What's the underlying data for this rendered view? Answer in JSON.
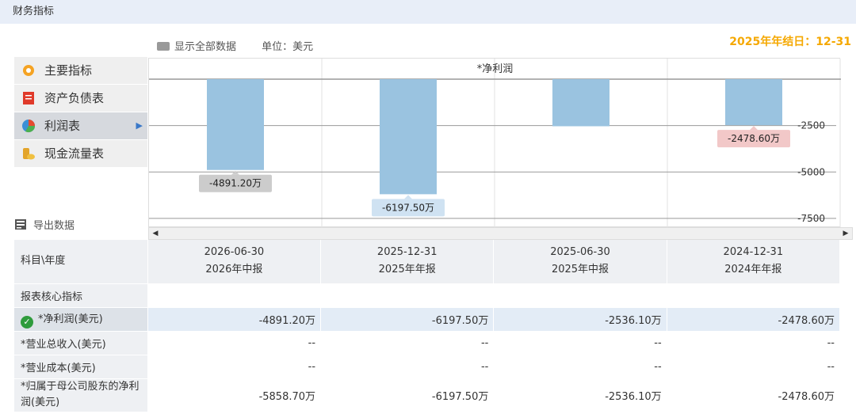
{
  "topbar": {
    "title": "财务指标"
  },
  "toolbar": {
    "show_all": "显示全部数据",
    "unit": "单位：美元"
  },
  "year_end": "2025年年结日：12-31",
  "nav": {
    "items": [
      {
        "label": "主要指标",
        "icon": "gear-icon"
      },
      {
        "label": "资产负债表",
        "icon": "document-icon"
      },
      {
        "label": "利润表",
        "icon": "pie-chart-icon"
      },
      {
        "label": "现金流量表",
        "icon": "coins-icon"
      }
    ],
    "active_index": 2,
    "export_label": "导出数据"
  },
  "chart_data": {
    "type": "bar",
    "title": "*净利润",
    "categories": [
      "2026-06-30",
      "2025-12-31",
      "2025-06-30",
      "2024-12-31"
    ],
    "values": [
      -4891.2,
      -6197.5,
      -2536.1,
      -2478.6
    ],
    "value_labels": [
      "-4891.20万",
      "-6197.50万",
      "",
      "-2478.60万"
    ],
    "y_ticks": [
      "-2500",
      "-5000",
      "-7500"
    ],
    "ylim": [
      -8100,
      0
    ],
    "bar_color": "#9ac3e0",
    "label_colors": [
      "#cccccc",
      "#cfe2f2",
      "",
      "#f2c8c8"
    ]
  },
  "table": {
    "header_label": "科目\\年度",
    "columns": [
      {
        "date": "2026-06-30",
        "report": "2026年中报"
      },
      {
        "date": "2025-12-31",
        "report": "2025年年报"
      },
      {
        "date": "2025-06-30",
        "report": "2025年中报"
      },
      {
        "date": "2024-12-31",
        "report": "2024年年报"
      }
    ],
    "core_label": "报表核心指标",
    "rows": [
      {
        "label": "*净利润(美元)",
        "values": [
          "-4891.20",
          "-6197.50",
          "-2536.10",
          "-2478.60"
        ],
        "unit": "万"
      },
      {
        "label": "*营业总收入(美元)",
        "values": [
          "--",
          "--",
          "--",
          "--"
        ],
        "unit": ""
      },
      {
        "label": "*营业成本(美元)",
        "values": [
          "--",
          "--",
          "--",
          "--"
        ],
        "unit": ""
      },
      {
        "label": "*归属于母公司股东的净利润(美元)",
        "values": [
          "-5858.70",
          "-6197.50",
          "-2536.10",
          "-2478.60"
        ],
        "unit": "万"
      }
    ]
  }
}
